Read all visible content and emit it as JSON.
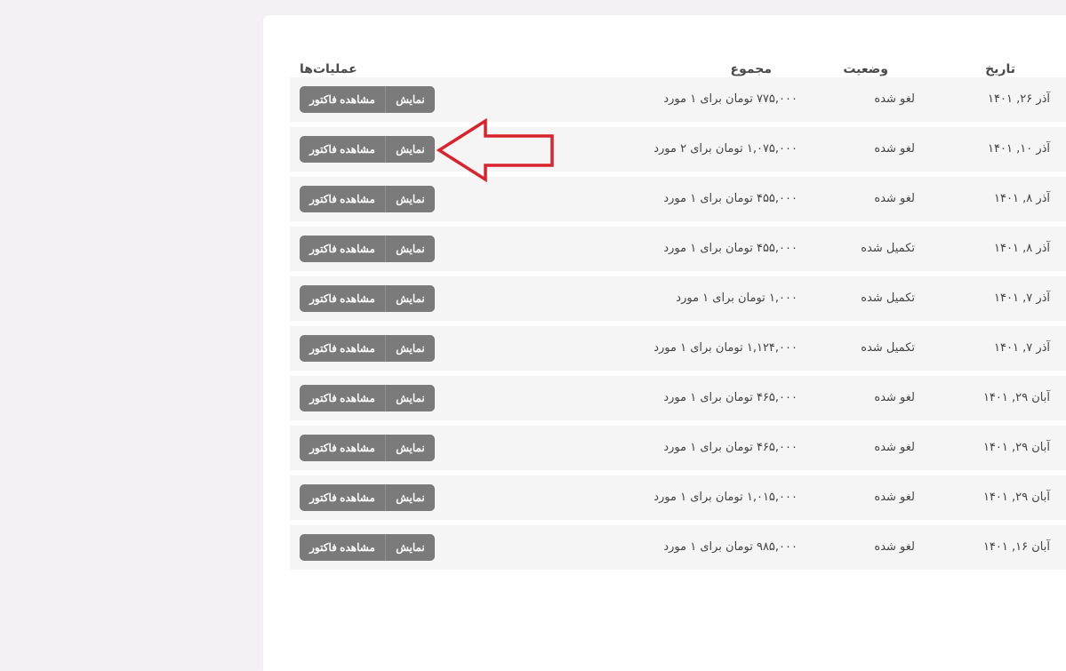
{
  "table": {
    "headers": {
      "date": "تاریخ",
      "status": "وضعیت",
      "total": "مجموع",
      "actions": "عملیات‌ها"
    },
    "buttons": {
      "show": "نمایش",
      "invoice": "مشاهده فاکتور"
    },
    "rows": [
      {
        "date": "آذر ۲۶, ۱۴۰۱",
        "status": "لغو شده",
        "total": "۷۷۵,۰۰۰ تومان برای ۱ مورد"
      },
      {
        "date": "آذر ۱۰, ۱۴۰۱",
        "status": "لغو شده",
        "total": "۱,۰۷۵,۰۰۰ تومان برای ۲ مورد"
      },
      {
        "date": "آذر ۸, ۱۴۰۱",
        "status": "لغو شده",
        "total": "۴۵۵,۰۰۰ تومان برای ۱ مورد"
      },
      {
        "date": "آذر ۸, ۱۴۰۱",
        "status": "تکمیل شده",
        "total": "۴۵۵,۰۰۰ تومان برای ۱ مورد"
      },
      {
        "date": "آذر ۷, ۱۴۰۱",
        "status": "تکمیل شده",
        "total": "۱,۰۰۰ تومان برای ۱ مورد"
      },
      {
        "date": "آذر ۷, ۱۴۰۱",
        "status": "تکمیل شده",
        "total": "۱,۱۲۴,۰۰۰ تومان برای ۱ مورد"
      },
      {
        "date": "آبان ۲۹, ۱۴۰۱",
        "status": "لغو شده",
        "total": "۴۶۵,۰۰۰ تومان برای ۱ مورد"
      },
      {
        "date": "آبان ۲۹, ۱۴۰۱",
        "status": "لغو شده",
        "total": "۴۶۵,۰۰۰ تومان برای ۱ مورد"
      },
      {
        "date": "آبان ۲۹, ۱۴۰۱",
        "status": "لغو شده",
        "total": "۱,۰۱۵,۰۰۰ تومان برای ۱ مورد"
      },
      {
        "date": "آبان ۱۶, ۱۴۰۱",
        "status": "لغو شده",
        "total": "۹۸۵,۰۰۰ تومان برای ۱ مورد"
      }
    ]
  },
  "colors": {
    "background": "#f3f0f6",
    "card": "#ffffff",
    "row": "#f5f5f5",
    "button": "#7a7a7a",
    "annotation_arrow": "#d9232d"
  },
  "annotation": {
    "icon": "red-arrow-icon",
    "points_to_row": 2
  }
}
